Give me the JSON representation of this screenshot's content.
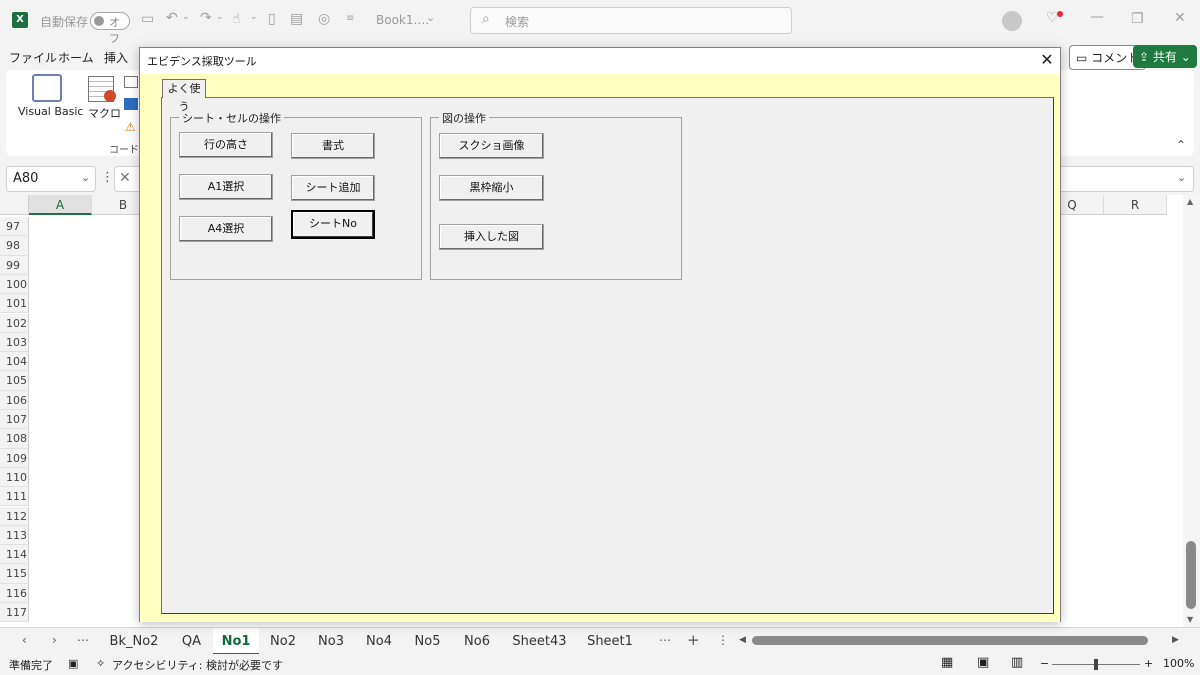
{
  "titlebar": {
    "autosave_label": "自動保存",
    "autosave_state": "オフ",
    "doc_name": "Book1.…",
    "search_placeholder": "検索"
  },
  "menu": {
    "items": [
      "ファイル",
      "ホーム",
      "挿入"
    ],
    "comment_label": "コメント",
    "share_label": "共有"
  },
  "ribbon": {
    "visual_basic_label": "Visual Basic",
    "macro_label": "マクロ",
    "group_label": "コード"
  },
  "formula_bar": {
    "name_box": "A80"
  },
  "grid": {
    "columns_left": [
      "A",
      "B"
    ],
    "columns_right": [
      "Q",
      "R"
    ],
    "rows": [
      "97",
      "98",
      "99",
      "100",
      "101",
      "102",
      "103",
      "104",
      "105",
      "106",
      "107",
      "108",
      "109",
      "110",
      "111",
      "112",
      "113",
      "114",
      "115",
      "116",
      "117"
    ]
  },
  "dialog": {
    "title": "エビデンス採取ツール",
    "close_glyph": "✕",
    "tab_label": "よく使う",
    "frame_sheet": {
      "caption": "シート・セルの操作",
      "buttons": [
        "行の高さ",
        "書式",
        "A1選択",
        "シート追加",
        "A4選択",
        "シートNo"
      ]
    },
    "frame_image": {
      "caption": "図の操作",
      "buttons": [
        "スクショ画像",
        "黒枠縮小",
        "挿入した図"
      ]
    }
  },
  "sheet_tabs": [
    "Bk_No2",
    "QA",
    "No1",
    "No2",
    "No3",
    "No4",
    "No5",
    "No6",
    "Sheet43",
    "Sheet1"
  ],
  "active_sheet": "No1",
  "status": {
    "ready": "準備完了",
    "accessibility": "アクセシビリティ: 検討が必要です",
    "zoom": "100%"
  },
  "colors": {
    "excel_green": "#217346",
    "share_green": "#1e7a3e",
    "dialog_bg": "#ffffc0",
    "control_bg": "#f0f0f0"
  }
}
